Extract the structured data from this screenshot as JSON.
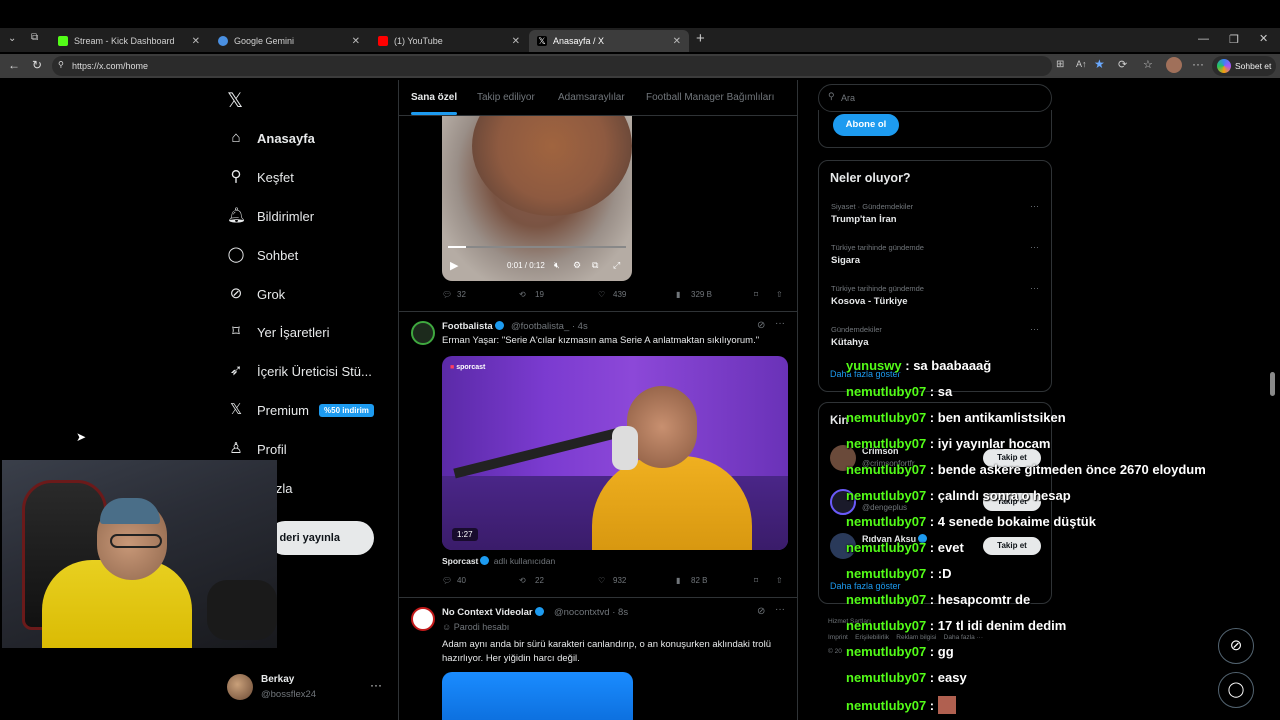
{
  "browser": {
    "tabs": [
      {
        "title": "Stream - Kick Dashboard",
        "color": "#53fc18"
      },
      {
        "title": "Google Gemini",
        "color": "#4a90e2"
      },
      {
        "title": "(1) YouTube",
        "color": "#ff0000"
      },
      {
        "title": "Anasayfa / X",
        "color": "#ffffff"
      }
    ],
    "url": "https://x.com/home",
    "copilot_label": "Sohbet et"
  },
  "nav": {
    "items": [
      {
        "label": "Anasayfa",
        "icon": "home-icon"
      },
      {
        "label": "Keşfet",
        "icon": "search-icon"
      },
      {
        "label": "Bildirimler",
        "icon": "bell-icon"
      },
      {
        "label": "Sohbet",
        "icon": "chat-icon"
      },
      {
        "label": "Grok",
        "icon": "grok-icon"
      },
      {
        "label": "Yer İşaretleri",
        "icon": "bookmark-icon"
      },
      {
        "label": "İçerik Üreticisi Stü...",
        "icon": "rocket-icon"
      },
      {
        "label": "Premium",
        "icon": "x-icon",
        "badge": "%50 indirim"
      },
      {
        "label": "Profil",
        "icon": "person-icon"
      },
      {
        "label": "ha fazla",
        "icon": "more-icon"
      }
    ],
    "post_button": "deri yayınla",
    "profile": {
      "name": "Berkay",
      "handle": "@bossflex24"
    }
  },
  "feed": {
    "tabs": [
      "Sana özel",
      "Takip ediliyor",
      "Adamsaraylılar",
      "Football Manager Bağımlıları"
    ],
    "post1": {
      "video_time": "0:01 / 0:12",
      "replies": "32",
      "reposts": "19",
      "likes": "439",
      "views": "329 B"
    },
    "post2": {
      "name": "Footbalista",
      "handle": "@footbalista_ · 4s",
      "text": "Erman Yaşar: \"Serie A'cılar kızmasın ama Serie A anlatmaktan sıkılıyorum.\"",
      "video_brand": "sporcast",
      "duration": "1:27",
      "source_name": "Sporcast",
      "source_note": "adlı kullanıcıdan",
      "replies": "40",
      "reposts": "22",
      "likes": "932",
      "views": "82 B"
    },
    "post3": {
      "name": "No Context Videolar",
      "handle": "@nocontxtvd · 8s",
      "label": "Parodi hesabı",
      "text": "Adam aynı anda bir sürü karakteri canlandırıp, o an konuşurken aklındaki trolü hazırlıyor. Her yiğidin harcı değil."
    }
  },
  "sidebar": {
    "search_placeholder": "Ara",
    "subscribe": "Abone ol",
    "trends_title": "Neler oluyor?",
    "trends": [
      {
        "category": "Siyaset · Gündemdekiler",
        "title": "Trump'tan İran"
      },
      {
        "category": "Türkiye tarihinde gündemde",
        "title": "Sigara"
      },
      {
        "category": "Türkiye tarihinde gündemde",
        "title": "Kosova - Türkiye"
      },
      {
        "category": "Gündemdekiler",
        "title": "Kütahya"
      }
    ],
    "show_more": "Daha fazla göster",
    "who_to_follow_prefix": "Kin",
    "follow_label": "Takip et",
    "suggestions": [
      {
        "name": "Crimson",
        "handle": "@crimsonfortfr"
      },
      {
        "name": "",
        "handle": "@dengeplus"
      },
      {
        "name": "Rıdvan Aksu",
        "handle": ""
      }
    ],
    "footer": {
      "line1": "Hizmet Şartları",
      "links": [
        "Imprint",
        "Erişilebilirlik",
        "Reklam bilgisi",
        "Daha fazla ···"
      ],
      "copyright": "© 20"
    }
  },
  "chat": [
    {
      "user": "yunuswy",
      "message": "sa baabaaağ"
    },
    {
      "user": "nemutluby07",
      "message": "sa"
    },
    {
      "user": "nemutluby07",
      "message": "ben antikamlistsiken"
    },
    {
      "user": "nemutluby07",
      "message": "iyi yayınlar hocam"
    },
    {
      "user": "nemutluby07",
      "message": "bende askere gitmeden önce 2670 eloydum"
    },
    {
      "user": "nemutluby07",
      "message": "çalındı sonra o hesap"
    },
    {
      "user": "nemutluby07",
      "message": "4 senede bokaime düştük"
    },
    {
      "user": "nemutluby07",
      "message": "evet"
    },
    {
      "user": "nemutluby07",
      "message": ":D"
    },
    {
      "user": "nemutluby07",
      "message": "hesapcomtr de"
    },
    {
      "user": "nemutluby07",
      "message": "17 tl idi denim dedim"
    },
    {
      "user": "nemutluby07",
      "message": "gg"
    },
    {
      "user": "nemutluby07",
      "message": "easy"
    },
    {
      "user": "nemutluby07",
      "message": ""
    }
  ]
}
